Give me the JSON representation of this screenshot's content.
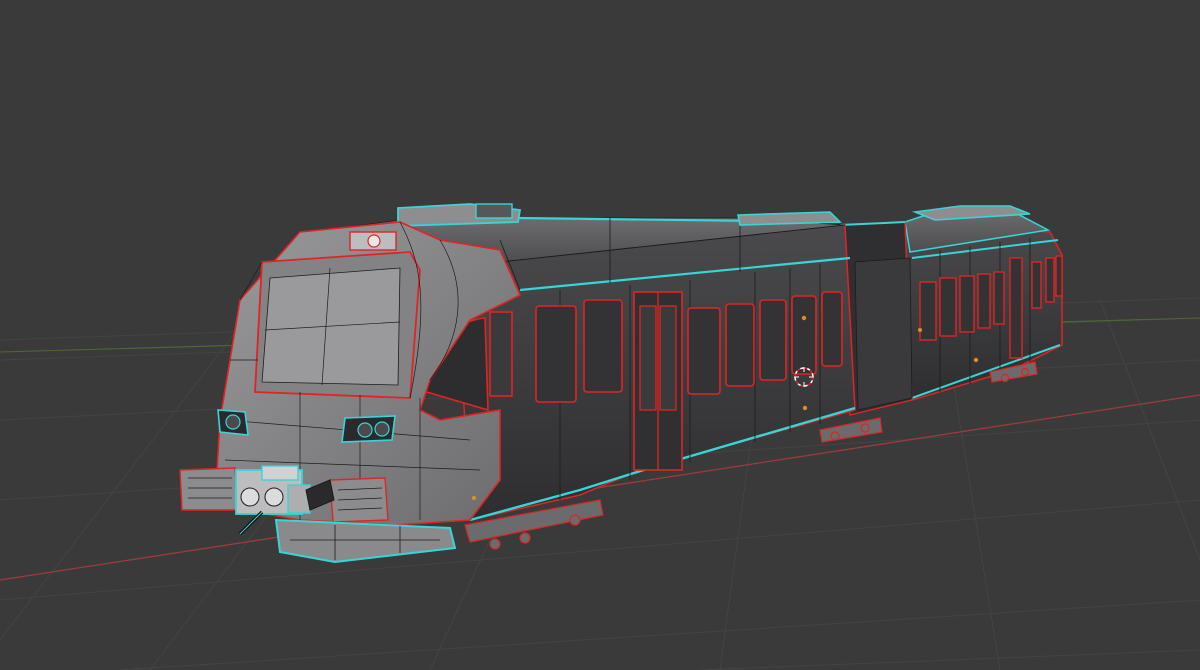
{
  "viewport": {
    "background": "#3a3a3a",
    "grid_color": "#444444",
    "x_axis_color": "#9c3b3b",
    "y_axis_color": "#4c6b33"
  },
  "model": {
    "body_fill_dark": "#363638",
    "body_fill_mid": "#474749",
    "body_fill_light": "#8a8a8c",
    "wire_color": "#1c1c1c",
    "seam_color": "#e02424",
    "selected_edge_color": "#37d5d8",
    "origin_color": "#e08a2a",
    "cursor_icon": "3d-cursor-icon"
  }
}
